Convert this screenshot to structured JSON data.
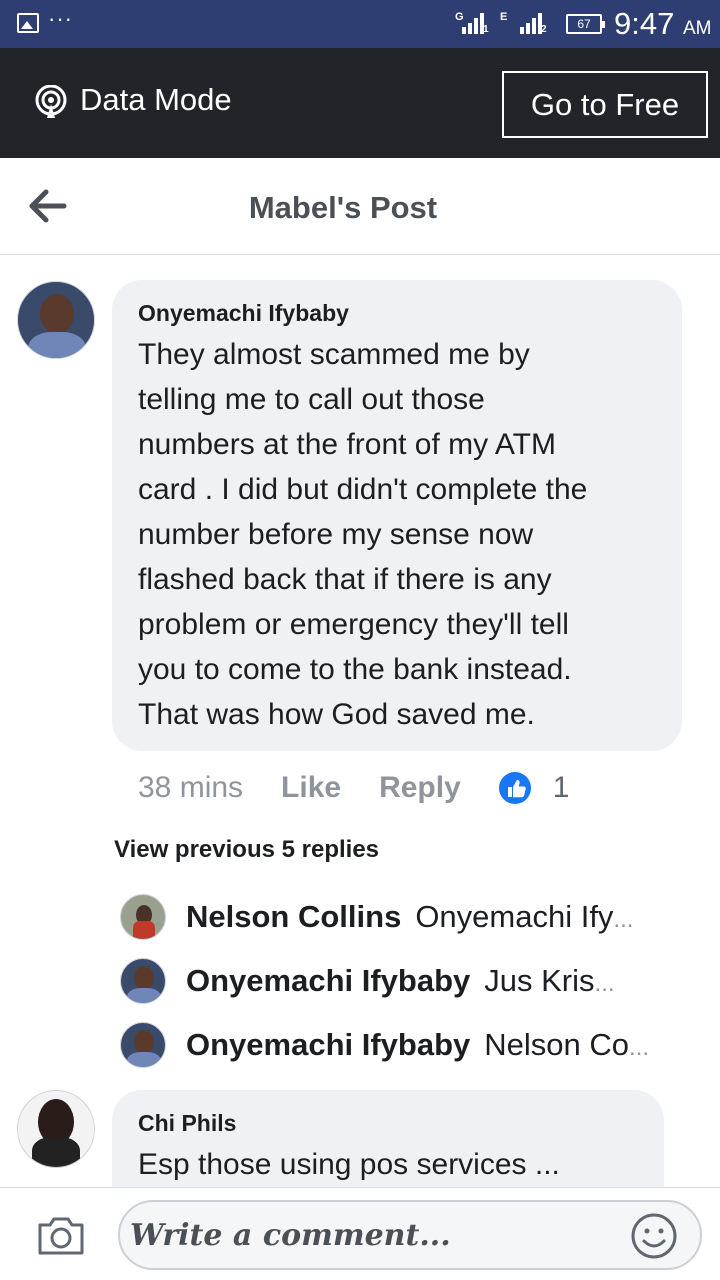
{
  "status_bar": {
    "network_1": "G",
    "sim_1": "1",
    "network_2": "E",
    "sim_2": "2",
    "battery": "67",
    "time": "9:47",
    "ampm": "AM"
  },
  "data_bar": {
    "mode_label": "Data Mode",
    "go_free_label": "Go to Free"
  },
  "header": {
    "title": "Mabel's Post"
  },
  "main_comment": {
    "author": "Onyemachi Ifybaby",
    "text": "They almost scammed me by\ntelling me to call out those\nnumbers at the front of my ATM\ncard .  I did but didn't complete the\nnumber before my sense now\nflashed back that if there is any\nproblem or emergency they'll tell\nyou to come to the bank instead.\nThat was how God saved me.",
    "time": "38 mins",
    "like_label": "Like",
    "reply_label": "Reply",
    "like_count": "1"
  },
  "replies_link": "View previous 5 replies",
  "replies": [
    {
      "author": "Nelson Collins",
      "text": "Onyemachi Ify",
      "ellipsis": "..."
    },
    {
      "author": "Onyemachi Ifybaby",
      "text": "Jus Kris",
      "ellipsis": "..."
    },
    {
      "author": "Onyemachi Ifybaby",
      "text": "Nelson Co",
      "ellipsis": "..."
    }
  ],
  "second_comment": {
    "author": "Chi Phils",
    "text": "Esp those using pos services ..."
  },
  "composer": {
    "placeholder": "Write a comment..."
  },
  "colors": {
    "status_bar": "#2e3e72",
    "data_bar": "#212529",
    "like_blue": "#1877f2",
    "bubble": "#f0f1f4"
  }
}
